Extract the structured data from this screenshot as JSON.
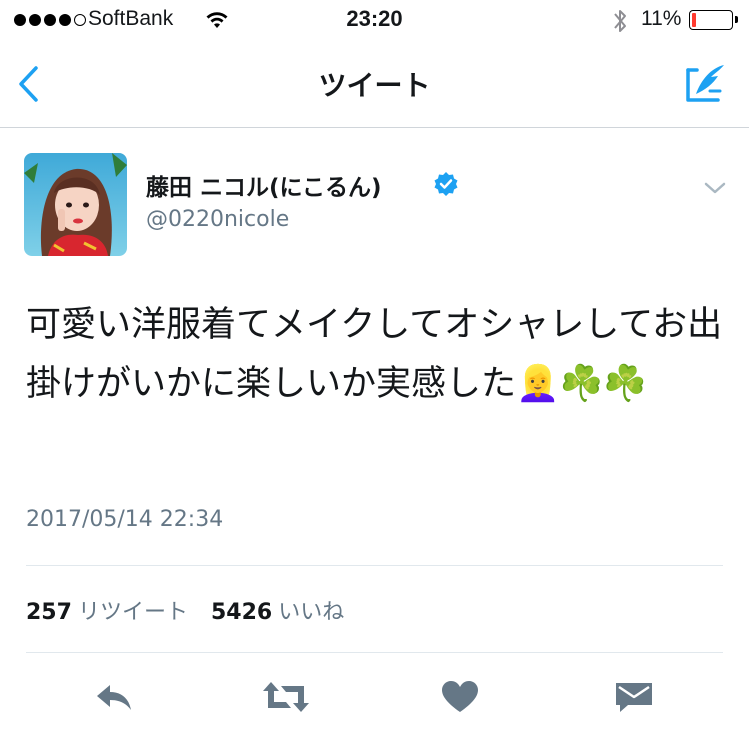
{
  "status_bar": {
    "carrier": "SoftBank",
    "time": "23:20",
    "battery_percent": "11%",
    "battery_level": 0.11,
    "signal_bars_filled": 4,
    "signal_bars_total": 5
  },
  "nav": {
    "title": "ツイート",
    "back_icon": "chevron-left-icon",
    "compose_icon": "compose-tweet-icon"
  },
  "tweet": {
    "display_name": "藤田 ニコル(にこるん)",
    "verified": true,
    "handle": "@0220nicole",
    "text": "可愛い洋服着てメイクしてオシャレしてお出掛けがいかに楽しいか実感した👱‍♀️☘️☘️",
    "timestamp": "2017/05/14 22:34",
    "retweet_count": "257",
    "retweet_label": "リツイート",
    "like_count": "5426",
    "like_label": "いいね"
  },
  "colors": {
    "accent": "#1da1f2",
    "secondary_text": "#657786",
    "icon_gray": "#657786",
    "battery_low": "#ff3b30"
  },
  "actions": [
    "reply-icon",
    "retweet-icon",
    "like-icon",
    "direct-message-icon"
  ]
}
